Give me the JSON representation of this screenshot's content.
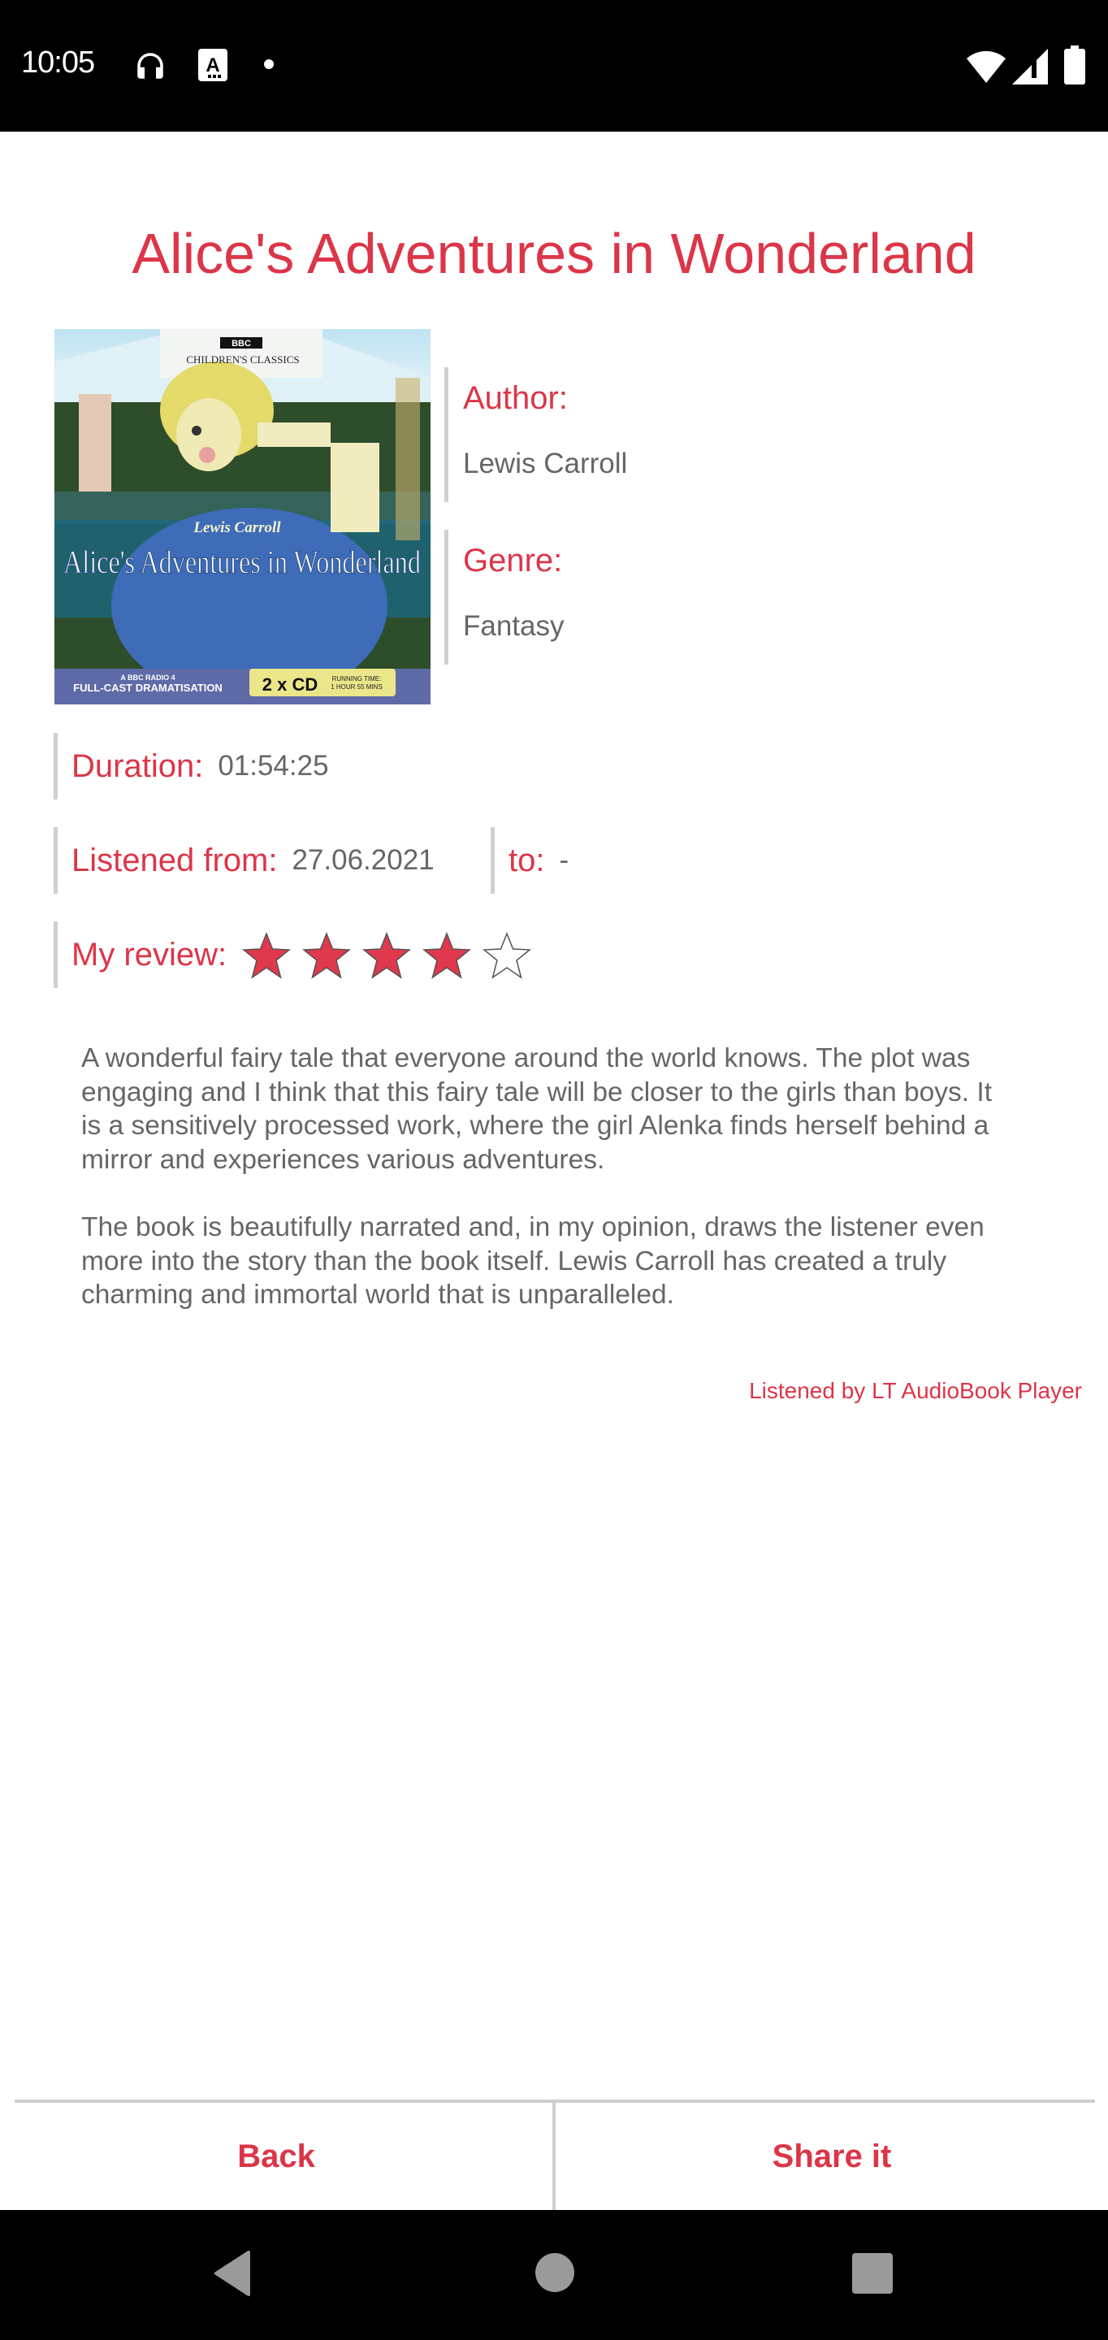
{
  "status_bar": {
    "time": "10:05",
    "left_icons": [
      "headphones-icon",
      "accessibility-a-icon",
      "dot-icon"
    ],
    "right_icons": [
      "wifi-icon",
      "signal-icon",
      "battery-icon"
    ]
  },
  "book": {
    "title": "Alice's Adventures in Wonderland",
    "cover": {
      "publisher_badge": "BBC",
      "series": "CHILDREN'S CLASSICS",
      "author_script": "Lewis Carroll",
      "title": "Alice's Adventures in Wonderland",
      "footer_left_small": "A BBC RADIO 4",
      "footer_left_big": "FULL-CAST DRAMATISATION",
      "footer_cd": "2 x CD",
      "footer_runtime_1": "RUNNING TIME:",
      "footer_runtime_2": "1 HOUR 55 MINS"
    },
    "author_label": "Author:",
    "author": "Lewis Carroll",
    "genre_label": "Genre:",
    "genre": "Fantasy",
    "duration_label": "Duration:",
    "duration": "01:54:25",
    "listened_from_label": "Listened from:",
    "listened_from": "27.06.2021",
    "to_label": "to:",
    "to": "-",
    "review_label": "My review:",
    "rating": 4,
    "rating_max": 5,
    "review_paragraphs": [
      "A wonderful fairy tale that everyone around the world knows. The plot was engaging and I think that this fairy tale will be closer to the girls than boys. It is a sensitively processed work, where the girl Alenka finds herself behind a mirror and experiences various adventures.",
      "The book is beautifully narrated and, in my opinion, draws the listener even more into the story than the book itself. Lewis Carroll has created a truly charming and immortal world that is unparalleled."
    ],
    "credit": "Listened by LT AudioBook Player"
  },
  "actions": {
    "back_label": "Back",
    "share_label": "Share it"
  },
  "colors": {
    "accent": "#dc3548",
    "text": "#666666",
    "divider": "#cfcfcf",
    "star_filled": "#e0384c",
    "star_empty": "#ffffff"
  },
  "nav_bar": {
    "buttons": [
      "back-nav-icon",
      "home-nav-icon",
      "recents-nav-icon"
    ]
  }
}
